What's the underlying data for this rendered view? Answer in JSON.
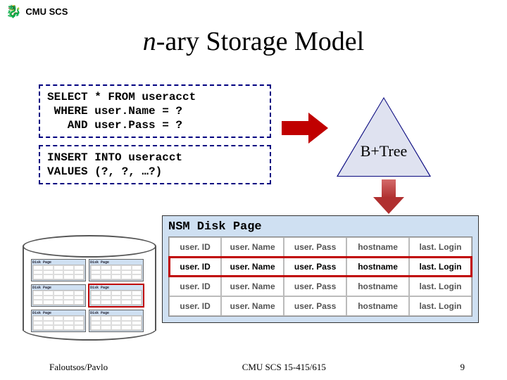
{
  "header": {
    "org": "CMU SCS"
  },
  "title": {
    "italic": "n",
    "rest": "-ary Storage Model"
  },
  "sql": {
    "select": {
      "l1": "SELECT * FROM useracct",
      "l2": " WHERE user.Name = ?",
      "l3": "   AND user.Pass = ?"
    },
    "insert": {
      "l1": "INSERT INTO useracct",
      "l2": "VALUES (?, ?, …?)"
    }
  },
  "btree": {
    "label": "B+Tree"
  },
  "disk": {
    "title": "NSM Disk Page",
    "columns": [
      "user. ID",
      "user. Name",
      "user. Pass",
      "hostname",
      "last. Login"
    ]
  },
  "cylinder": {
    "page_label": "Disk Page"
  },
  "footer": {
    "left": "Faloutsos/Pavlo",
    "center": "CMU SCS 15-415/615",
    "right": "9"
  }
}
